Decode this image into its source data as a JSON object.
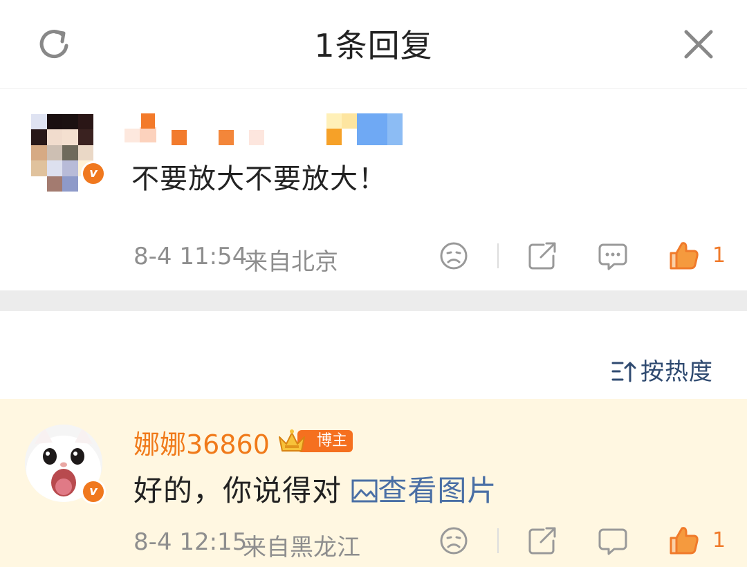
{
  "header": {
    "title": "1条回复"
  },
  "main_comment": {
    "text": "不要放大不要放大！",
    "timestamp": "8-4 11:54",
    "location": "来自北京",
    "likes": "1"
  },
  "sort": {
    "label": "按热度"
  },
  "reply": {
    "username": "娜娜36860",
    "badge_label": "博主",
    "text": "好的，你说得对",
    "view_image_label": "查看图片",
    "timestamp": "8-4 12:15",
    "location": "来自黑龙江",
    "likes": "1"
  },
  "colors": {
    "accent_orange": "#f07a1a",
    "link_blue": "#4a6fa5",
    "reply_highlight": "#fff7e1"
  }
}
